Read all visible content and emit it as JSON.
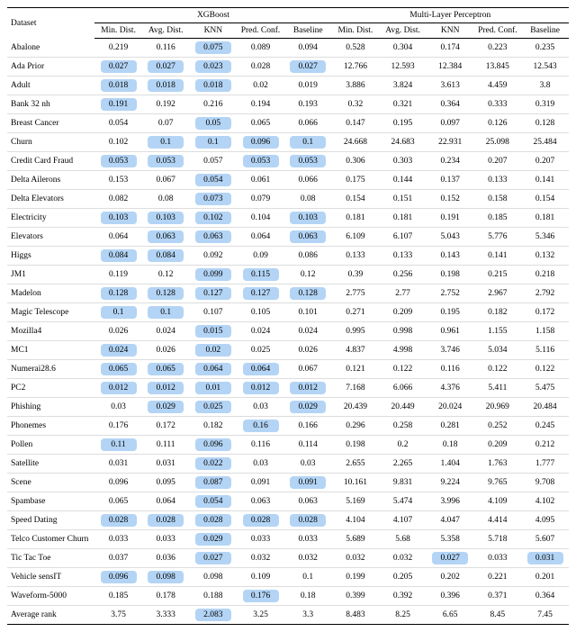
{
  "header": {
    "dataset": "Dataset",
    "groups": [
      "XGBoost",
      "Multi-Layer Perceptron"
    ],
    "metrics": [
      "Min. Dist.",
      "Avg. Dist.",
      "KNN",
      "Pred. Conf.",
      "Baseline"
    ]
  },
  "rows": [
    {
      "name": "Abalone",
      "xgb": [
        {
          "v": "0.219"
        },
        {
          "v": "0.116"
        },
        {
          "v": "0.075",
          "h": true
        },
        {
          "v": "0.089"
        },
        {
          "v": "0.094"
        }
      ],
      "mlp": [
        {
          "v": "0.528"
        },
        {
          "v": "0.304"
        },
        {
          "v": "0.174"
        },
        {
          "v": "0.223"
        },
        {
          "v": "0.235"
        }
      ]
    },
    {
      "name": "Ada Prior",
      "xgb": [
        {
          "v": "0.027",
          "h": true
        },
        {
          "v": "0.027",
          "h": true
        },
        {
          "v": "0.023",
          "h": true
        },
        {
          "v": "0.028"
        },
        {
          "v": "0.027",
          "h": true
        }
      ],
      "mlp": [
        {
          "v": "12.766"
        },
        {
          "v": "12.593"
        },
        {
          "v": "12.384"
        },
        {
          "v": "13.845"
        },
        {
          "v": "12.543"
        }
      ]
    },
    {
      "name": "Adult",
      "xgb": [
        {
          "v": "0.018",
          "h": true
        },
        {
          "v": "0.018",
          "h": true
        },
        {
          "v": "0.018",
          "h": true
        },
        {
          "v": "0.02"
        },
        {
          "v": "0.019"
        }
      ],
      "mlp": [
        {
          "v": "3.886"
        },
        {
          "v": "3.824"
        },
        {
          "v": "3.613"
        },
        {
          "v": "4.459"
        },
        {
          "v": "3.8"
        }
      ]
    },
    {
      "name": "Bank 32 nh",
      "xgb": [
        {
          "v": "0.191",
          "h": true
        },
        {
          "v": "0.192"
        },
        {
          "v": "0.216"
        },
        {
          "v": "0.194"
        },
        {
          "v": "0.193"
        }
      ],
      "mlp": [
        {
          "v": "0.32"
        },
        {
          "v": "0.321"
        },
        {
          "v": "0.364"
        },
        {
          "v": "0.333"
        },
        {
          "v": "0.319"
        }
      ]
    },
    {
      "name": "Breast Cancer",
      "xgb": [
        {
          "v": "0.054"
        },
        {
          "v": "0.07"
        },
        {
          "v": "0.05",
          "h": true
        },
        {
          "v": "0.065"
        },
        {
          "v": "0.066"
        }
      ],
      "mlp": [
        {
          "v": "0.147"
        },
        {
          "v": "0.195"
        },
        {
          "v": "0.097"
        },
        {
          "v": "0.126"
        },
        {
          "v": "0.128"
        }
      ]
    },
    {
      "name": "Churn",
      "xgb": [
        {
          "v": "0.102"
        },
        {
          "v": "0.1",
          "h": true
        },
        {
          "v": "0.1",
          "h": true
        },
        {
          "v": "0.096",
          "h": true
        },
        {
          "v": "0.1",
          "h": true
        }
      ],
      "mlp": [
        {
          "v": "24.668"
        },
        {
          "v": "24.683"
        },
        {
          "v": "22.931"
        },
        {
          "v": "25.098"
        },
        {
          "v": "25.484"
        }
      ]
    },
    {
      "name": "Credit Card Fraud",
      "xgb": [
        {
          "v": "0.053",
          "h": true
        },
        {
          "v": "0.053",
          "h": true
        },
        {
          "v": "0.057"
        },
        {
          "v": "0.053",
          "h": true
        },
        {
          "v": "0.053",
          "h": true
        }
      ],
      "mlp": [
        {
          "v": "0.306"
        },
        {
          "v": "0.303"
        },
        {
          "v": "0.234"
        },
        {
          "v": "0.207"
        },
        {
          "v": "0.207"
        }
      ]
    },
    {
      "name": "Delta Ailerons",
      "xgb": [
        {
          "v": "0.153"
        },
        {
          "v": "0.067"
        },
        {
          "v": "0.054",
          "h": true
        },
        {
          "v": "0.061"
        },
        {
          "v": "0.066"
        }
      ],
      "mlp": [
        {
          "v": "0.175"
        },
        {
          "v": "0.144"
        },
        {
          "v": "0.137"
        },
        {
          "v": "0.133"
        },
        {
          "v": "0.141"
        }
      ]
    },
    {
      "name": "Delta Elevators",
      "xgb": [
        {
          "v": "0.082"
        },
        {
          "v": "0.08"
        },
        {
          "v": "0.073",
          "h": true
        },
        {
          "v": "0.079"
        },
        {
          "v": "0.08"
        }
      ],
      "mlp": [
        {
          "v": "0.154"
        },
        {
          "v": "0.151"
        },
        {
          "v": "0.152"
        },
        {
          "v": "0.158"
        },
        {
          "v": "0.154"
        }
      ]
    },
    {
      "name": "Electricity",
      "xgb": [
        {
          "v": "0.103",
          "h": true
        },
        {
          "v": "0.103",
          "h": true
        },
        {
          "v": "0.102",
          "h": true
        },
        {
          "v": "0.104"
        },
        {
          "v": "0.103",
          "h": true
        }
      ],
      "mlp": [
        {
          "v": "0.181"
        },
        {
          "v": "0.181"
        },
        {
          "v": "0.191"
        },
        {
          "v": "0.185"
        },
        {
          "v": "0.181"
        }
      ]
    },
    {
      "name": "Elevators",
      "xgb": [
        {
          "v": "0.064"
        },
        {
          "v": "0.063",
          "h": true
        },
        {
          "v": "0.063",
          "h": true
        },
        {
          "v": "0.064"
        },
        {
          "v": "0.063",
          "h": true
        }
      ],
      "mlp": [
        {
          "v": "6.109"
        },
        {
          "v": "6.107"
        },
        {
          "v": "5.043"
        },
        {
          "v": "5.776"
        },
        {
          "v": "5.346"
        }
      ]
    },
    {
      "name": "Higgs",
      "xgb": [
        {
          "v": "0.084",
          "h": true
        },
        {
          "v": "0.084",
          "h": true
        },
        {
          "v": "0.092"
        },
        {
          "v": "0.09"
        },
        {
          "v": "0.086"
        }
      ],
      "mlp": [
        {
          "v": "0.133"
        },
        {
          "v": "0.133"
        },
        {
          "v": "0.143"
        },
        {
          "v": "0.141"
        },
        {
          "v": "0.132"
        }
      ]
    },
    {
      "name": "JM1",
      "xgb": [
        {
          "v": "0.119"
        },
        {
          "v": "0.12"
        },
        {
          "v": "0.099",
          "h": true
        },
        {
          "v": "0.115",
          "h": true
        },
        {
          "v": "0.12"
        }
      ],
      "mlp": [
        {
          "v": "0.39"
        },
        {
          "v": "0.256"
        },
        {
          "v": "0.198"
        },
        {
          "v": "0.215"
        },
        {
          "v": "0.218"
        }
      ]
    },
    {
      "name": "Madelon",
      "xgb": [
        {
          "v": "0.128",
          "h": true
        },
        {
          "v": "0.128",
          "h": true
        },
        {
          "v": "0.127",
          "h": true
        },
        {
          "v": "0.127",
          "h": true
        },
        {
          "v": "0.128",
          "h": true
        }
      ],
      "mlp": [
        {
          "v": "2.775"
        },
        {
          "v": "2.77"
        },
        {
          "v": "2.752"
        },
        {
          "v": "2.967"
        },
        {
          "v": "2.792"
        }
      ]
    },
    {
      "name": "Magic Telescope",
      "xgb": [
        {
          "v": "0.1",
          "h": true
        },
        {
          "v": "0.1",
          "h": true
        },
        {
          "v": "0.107"
        },
        {
          "v": "0.105"
        },
        {
          "v": "0.101"
        }
      ],
      "mlp": [
        {
          "v": "0.271"
        },
        {
          "v": "0.209"
        },
        {
          "v": "0.195"
        },
        {
          "v": "0.182"
        },
        {
          "v": "0.172"
        }
      ]
    },
    {
      "name": "Mozilla4",
      "xgb": [
        {
          "v": "0.026"
        },
        {
          "v": "0.024"
        },
        {
          "v": "0.015",
          "h": true
        },
        {
          "v": "0.024"
        },
        {
          "v": "0.024"
        }
      ],
      "mlp": [
        {
          "v": "0.995"
        },
        {
          "v": "0.998"
        },
        {
          "v": "0.961"
        },
        {
          "v": "1.155"
        },
        {
          "v": "1.158"
        }
      ]
    },
    {
      "name": "MC1",
      "xgb": [
        {
          "v": "0.024",
          "h": true
        },
        {
          "v": "0.026"
        },
        {
          "v": "0.02",
          "h": true
        },
        {
          "v": "0.025"
        },
        {
          "v": "0.026"
        }
      ],
      "mlp": [
        {
          "v": "4.837"
        },
        {
          "v": "4.998"
        },
        {
          "v": "3.746"
        },
        {
          "v": "5.034"
        },
        {
          "v": "5.116"
        }
      ]
    },
    {
      "name": "Numerai28.6",
      "xgb": [
        {
          "v": "0.065",
          "h": true
        },
        {
          "v": "0.065",
          "h": true
        },
        {
          "v": "0.064",
          "h": true
        },
        {
          "v": "0.064",
          "h": true
        },
        {
          "v": "0.067"
        }
      ],
      "mlp": [
        {
          "v": "0.121"
        },
        {
          "v": "0.122"
        },
        {
          "v": "0.116"
        },
        {
          "v": "0.122"
        },
        {
          "v": "0.122"
        }
      ]
    },
    {
      "name": "PC2",
      "xgb": [
        {
          "v": "0.012",
          "h": true
        },
        {
          "v": "0.012",
          "h": true
        },
        {
          "v": "0.01",
          "h": true
        },
        {
          "v": "0.012",
          "h": true
        },
        {
          "v": "0.012",
          "h": true
        }
      ],
      "mlp": [
        {
          "v": "7.168"
        },
        {
          "v": "6.066"
        },
        {
          "v": "4.376"
        },
        {
          "v": "5.411"
        },
        {
          "v": "5.475"
        }
      ]
    },
    {
      "name": "Phishing",
      "xgb": [
        {
          "v": "0.03"
        },
        {
          "v": "0.029",
          "h": true
        },
        {
          "v": "0.025",
          "h": true
        },
        {
          "v": "0.03"
        },
        {
          "v": "0.029",
          "h": true
        }
      ],
      "mlp": [
        {
          "v": "20.439"
        },
        {
          "v": "20.449"
        },
        {
          "v": "20.024"
        },
        {
          "v": "20.969"
        },
        {
          "v": "20.484"
        }
      ]
    },
    {
      "name": "Phonemes",
      "xgb": [
        {
          "v": "0.176"
        },
        {
          "v": "0.172"
        },
        {
          "v": "0.182"
        },
        {
          "v": "0.16",
          "h": true
        },
        {
          "v": "0.166"
        }
      ],
      "mlp": [
        {
          "v": "0.296"
        },
        {
          "v": "0.258"
        },
        {
          "v": "0.281"
        },
        {
          "v": "0.252"
        },
        {
          "v": "0.245"
        }
      ]
    },
    {
      "name": "Pollen",
      "xgb": [
        {
          "v": "0.11",
          "h": true
        },
        {
          "v": "0.111"
        },
        {
          "v": "0.096",
          "h": true
        },
        {
          "v": "0.116"
        },
        {
          "v": "0.114"
        }
      ],
      "mlp": [
        {
          "v": "0.198"
        },
        {
          "v": "0.2"
        },
        {
          "v": "0.18"
        },
        {
          "v": "0.209"
        },
        {
          "v": "0.212"
        }
      ]
    },
    {
      "name": "Satellite",
      "xgb": [
        {
          "v": "0.031"
        },
        {
          "v": "0.031"
        },
        {
          "v": "0.022",
          "h": true
        },
        {
          "v": "0.03"
        },
        {
          "v": "0.03"
        }
      ],
      "mlp": [
        {
          "v": "2.655"
        },
        {
          "v": "2.265"
        },
        {
          "v": "1.404"
        },
        {
          "v": "1.763"
        },
        {
          "v": "1.777"
        }
      ]
    },
    {
      "name": "Scene",
      "xgb": [
        {
          "v": "0.096"
        },
        {
          "v": "0.095"
        },
        {
          "v": "0.087",
          "h": true
        },
        {
          "v": "0.091"
        },
        {
          "v": "0.091",
          "h": true
        }
      ],
      "mlp": [
        {
          "v": "10.161"
        },
        {
          "v": "9.831"
        },
        {
          "v": "9.224"
        },
        {
          "v": "9.765"
        },
        {
          "v": "9.708"
        }
      ]
    },
    {
      "name": "Spambase",
      "xgb": [
        {
          "v": "0.065"
        },
        {
          "v": "0.064"
        },
        {
          "v": "0.054",
          "h": true
        },
        {
          "v": "0.063"
        },
        {
          "v": "0.063"
        }
      ],
      "mlp": [
        {
          "v": "5.169"
        },
        {
          "v": "5.474"
        },
        {
          "v": "3.996"
        },
        {
          "v": "4.109"
        },
        {
          "v": "4.102"
        }
      ]
    },
    {
      "name": "Speed Dating",
      "xgb": [
        {
          "v": "0.028",
          "h": true
        },
        {
          "v": "0.028",
          "h": true
        },
        {
          "v": "0.028",
          "h": true
        },
        {
          "v": "0.028",
          "h": true
        },
        {
          "v": "0.028",
          "h": true
        }
      ],
      "mlp": [
        {
          "v": "4.104"
        },
        {
          "v": "4.107"
        },
        {
          "v": "4.047"
        },
        {
          "v": "4.414"
        },
        {
          "v": "4.095"
        }
      ]
    },
    {
      "name": "Telco Customer Churn",
      "xgb": [
        {
          "v": "0.033"
        },
        {
          "v": "0.033"
        },
        {
          "v": "0.029",
          "h": true
        },
        {
          "v": "0.033"
        },
        {
          "v": "0.033"
        }
      ],
      "mlp": [
        {
          "v": "5.689"
        },
        {
          "v": "5.68"
        },
        {
          "v": "5.358"
        },
        {
          "v": "5.718"
        },
        {
          "v": "5.607"
        }
      ]
    },
    {
      "name": "Tic Tac Toe",
      "xgb": [
        {
          "v": "0.037"
        },
        {
          "v": "0.036"
        },
        {
          "v": "0.027",
          "h": true
        },
        {
          "v": "0.032"
        },
        {
          "v": "0.032"
        }
      ],
      "mlp": [
        {
          "v": "0.032"
        },
        {
          "v": "0.032"
        },
        {
          "v": "0.027",
          "h": true
        },
        {
          "v": "0.033"
        },
        {
          "v": "0.031",
          "h": true
        }
      ]
    },
    {
      "name": "Vehicle sensIT",
      "xgb": [
        {
          "v": "0.096",
          "h": true
        },
        {
          "v": "0.098",
          "h": true
        },
        {
          "v": "0.098"
        },
        {
          "v": "0.109"
        },
        {
          "v": "0.1"
        }
      ],
      "mlp": [
        {
          "v": "0.199"
        },
        {
          "v": "0.205"
        },
        {
          "v": "0.202"
        },
        {
          "v": "0.221"
        },
        {
          "v": "0.201"
        }
      ]
    },
    {
      "name": "Waveform-5000",
      "xgb": [
        {
          "v": "0.185"
        },
        {
          "v": "0.178"
        },
        {
          "v": "0.188"
        },
        {
          "v": "0.176",
          "h": true
        },
        {
          "v": "0.18"
        }
      ],
      "mlp": [
        {
          "v": "0.399"
        },
        {
          "v": "0.392"
        },
        {
          "v": "0.396"
        },
        {
          "v": "0.371"
        },
        {
          "v": "0.364"
        }
      ]
    }
  ],
  "avg": {
    "name": "Average rank",
    "xgb": [
      {
        "v": "3.75"
      },
      {
        "v": "3.333"
      },
      {
        "v": "2.083",
        "h": true
      },
      {
        "v": "3.25"
      },
      {
        "v": "3.3"
      }
    ],
    "mlp": [
      {
        "v": "8.483"
      },
      {
        "v": "8.25"
      },
      {
        "v": "6.65"
      },
      {
        "v": "8.45"
      },
      {
        "v": "7.45"
      }
    ]
  }
}
